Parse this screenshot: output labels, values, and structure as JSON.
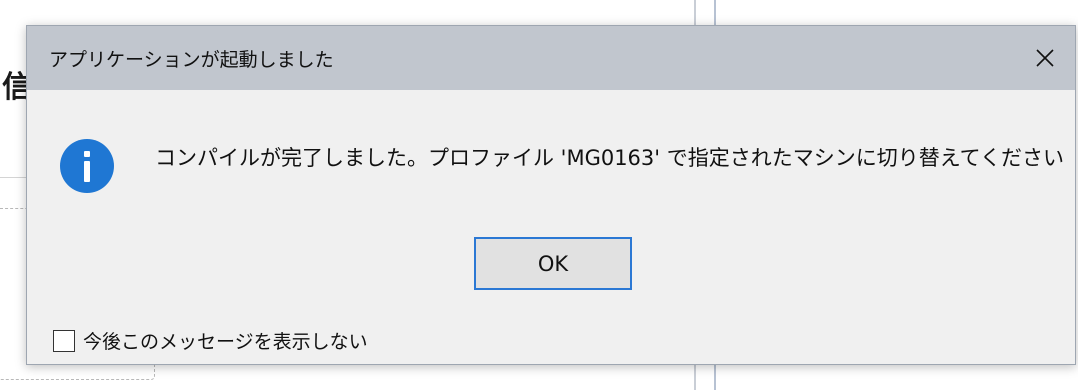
{
  "background": {
    "partial_char": "信"
  },
  "dialog": {
    "title": "アプリケーションが起動しました",
    "close_icon": "close-icon",
    "info_icon": "info-icon",
    "message": "コンパイルが完了しました。プロファイル 'MG0163' で指定されたマシンに切り替えてください",
    "ok_label": "OK",
    "checkbox_label": "今後このメッセージを表示しない",
    "checkbox_checked": false
  },
  "colors": {
    "titlebar": "#c1c6ce",
    "body": "#f0f0f0",
    "accent": "#2b78d4",
    "info_icon": "#1f77d3"
  }
}
